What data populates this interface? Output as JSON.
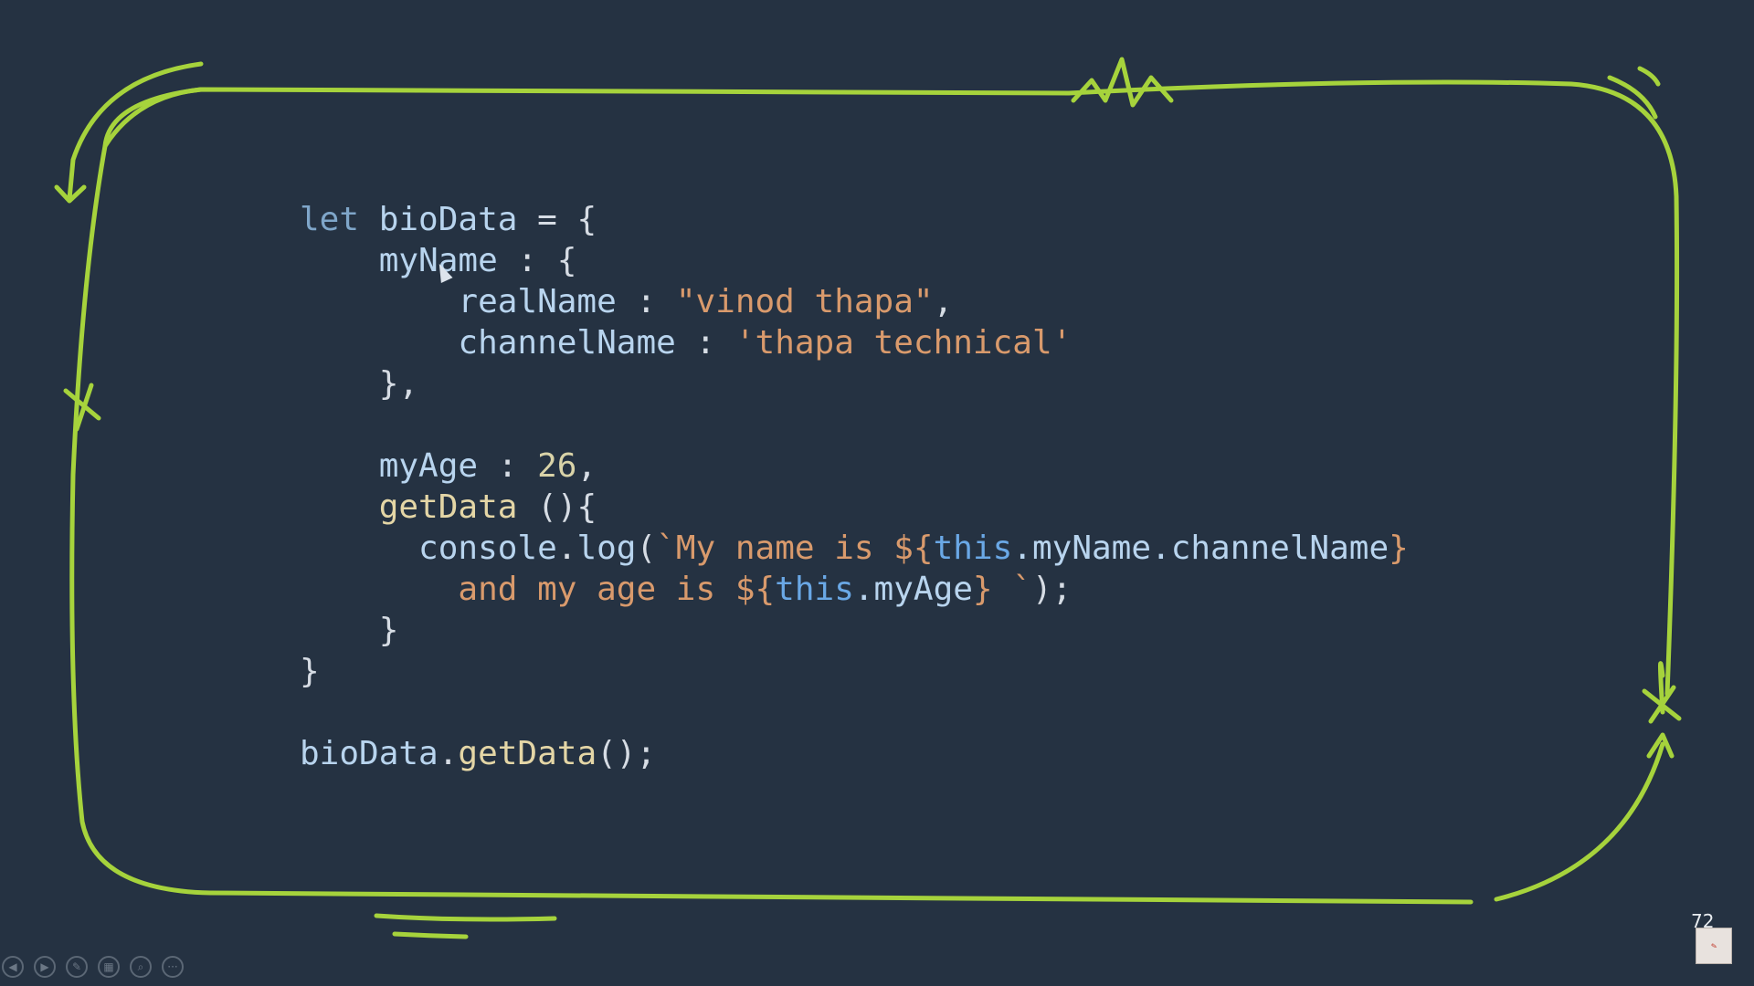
{
  "code": {
    "lines": [
      [
        {
          "t": "let ",
          "c": "kw"
        },
        {
          "t": "bioData",
          "c": "id"
        },
        {
          "t": " = {",
          "c": "pn"
        }
      ],
      [
        {
          "t": "    myName",
          "c": "id"
        },
        {
          "t": " : {",
          "c": "pn"
        }
      ],
      [
        {
          "t": "        realName",
          "c": "id"
        },
        {
          "t": " : ",
          "c": "pn"
        },
        {
          "t": "\"vinod thapa\"",
          "c": "str"
        },
        {
          "t": ",",
          "c": "pn"
        }
      ],
      [
        {
          "t": "        channelName",
          "c": "id"
        },
        {
          "t": " : ",
          "c": "pn"
        },
        {
          "t": "'thapa technical'",
          "c": "str"
        }
      ],
      [
        {
          "t": "    },",
          "c": "pn"
        }
      ],
      [
        {
          "t": "",
          "c": "pn"
        }
      ],
      [
        {
          "t": "    myAge",
          "c": "id"
        },
        {
          "t": " : ",
          "c": "pn"
        },
        {
          "t": "26",
          "c": "num"
        },
        {
          "t": ",",
          "c": "pn"
        }
      ],
      [
        {
          "t": "    getData",
          "c": "fn"
        },
        {
          "t": " (){",
          "c": "pn"
        }
      ],
      [
        {
          "t": "      console",
          "c": "id"
        },
        {
          "t": ".",
          "c": "pn"
        },
        {
          "t": "log",
          "c": "id"
        },
        {
          "t": "(",
          "c": "pn"
        },
        {
          "t": "`My name is ${",
          "c": "str"
        },
        {
          "t": "this",
          "c": "this"
        },
        {
          "t": ".myName.channelName",
          "c": "id"
        },
        {
          "t": "}",
          "c": "str"
        }
      ],
      [
        {
          "t": "        and my age is ${",
          "c": "str"
        },
        {
          "t": "this",
          "c": "this"
        },
        {
          "t": ".myAge",
          "c": "id"
        },
        {
          "t": "} `",
          "c": "str"
        },
        {
          "t": ");",
          "c": "pn"
        }
      ],
      [
        {
          "t": "    }",
          "c": "pn"
        }
      ],
      [
        {
          "t": "}",
          "c": "pn"
        }
      ],
      [
        {
          "t": "",
          "c": "pn"
        }
      ],
      [
        {
          "t": "bioData",
          "c": "id"
        },
        {
          "t": ".",
          "c": "pn"
        },
        {
          "t": "getData",
          "c": "fn"
        },
        {
          "t": "();",
          "c": "pn"
        }
      ]
    ]
  },
  "controls": [
    {
      "icon": "previous-slide-icon",
      "glyph": "◀"
    },
    {
      "icon": "next-slide-icon",
      "glyph": "▶"
    },
    {
      "icon": "pen-icon",
      "glyph": "✎"
    },
    {
      "icon": "slides-grid-icon",
      "glyph": "▦"
    },
    {
      "icon": "zoom-icon",
      "glyph": "⌕"
    },
    {
      "icon": "more-options-icon",
      "glyph": "···"
    }
  ],
  "slide_number": "72",
  "colors": {
    "background": "#253242",
    "frame": "#a6d33c",
    "string": "#d99a6c",
    "keyword": "#7fa6c9",
    "identifier": "#b8d4ee",
    "this": "#6aa8e6"
  }
}
